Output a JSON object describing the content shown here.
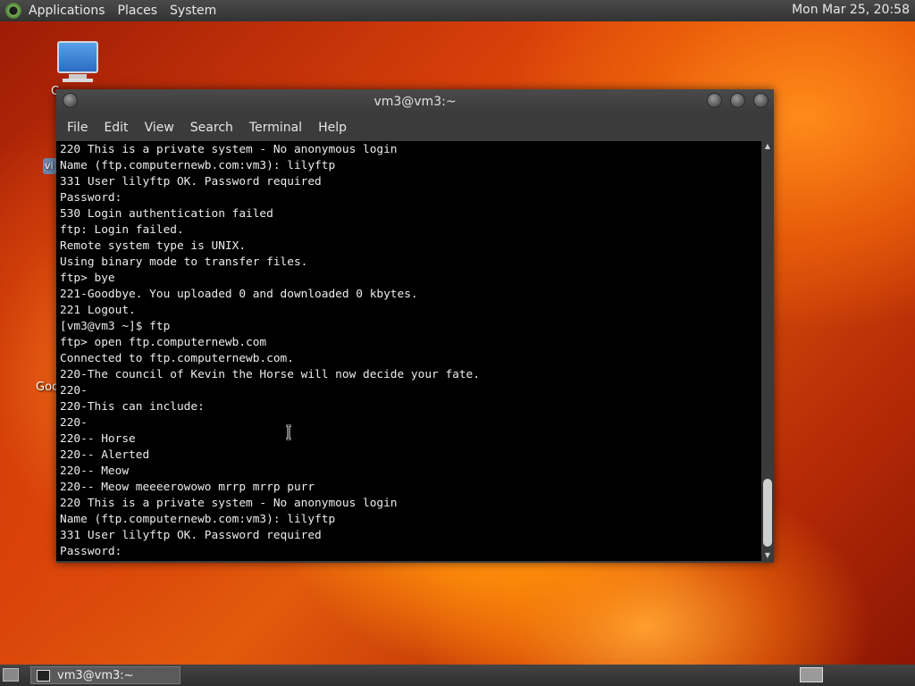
{
  "top_panel": {
    "menus": [
      "Applications",
      "Places",
      "System"
    ],
    "clock": "Mon Mar 25, 20:58"
  },
  "desktop": {
    "icon1_label_fragment": "C",
    "icon2_label_fragment": "vi",
    "icon3_label_fragment": "Goo"
  },
  "window": {
    "title": "vm3@vm3:~",
    "menu": [
      "File",
      "Edit",
      "View",
      "Search",
      "Terminal",
      "Help"
    ],
    "terminal_lines": [
      "220 This is a private system - No anonymous login",
      "Name (ftp.computernewb.com:vm3): lilyftp",
      "331 User lilyftp OK. Password required",
      "Password:",
      "530 Login authentication failed",
      "ftp: Login failed.",
      "Remote system type is UNIX.",
      "Using binary mode to transfer files.",
      "ftp> bye",
      "221-Goodbye. You uploaded 0 and downloaded 0 kbytes.",
      "221 Logout.",
      "[vm3@vm3 ~]$ ftp",
      "ftp> open ftp.computernewb.com",
      "Connected to ftp.computernewb.com.",
      "220-The council of Kevin the Horse will now decide your fate.",
      "220-",
      "220-This can include:",
      "220-",
      "220-- Horse",
      "220-- Alerted",
      "220-- Meow",
      "220-- Meow meeeerowowo mrrp mrrp purr",
      "220 This is a private system - No anonymous login",
      "Name (ftp.computernewb.com:vm3): lilyftp",
      "331 User lilyftp OK. Password required",
      "Password:"
    ]
  },
  "taskbar": {
    "task_label": "vm3@vm3:~"
  },
  "icons": {
    "menu_logo": "gnome-foot-icon",
    "computer": "computer-monitor-icon",
    "terminal": "terminal-icon",
    "workspace": "workspace-switcher-icon",
    "scroll_up": "chevron-up-icon",
    "scroll_down": "chevron-down-icon",
    "pointer": "ibeam-cursor-icon"
  }
}
